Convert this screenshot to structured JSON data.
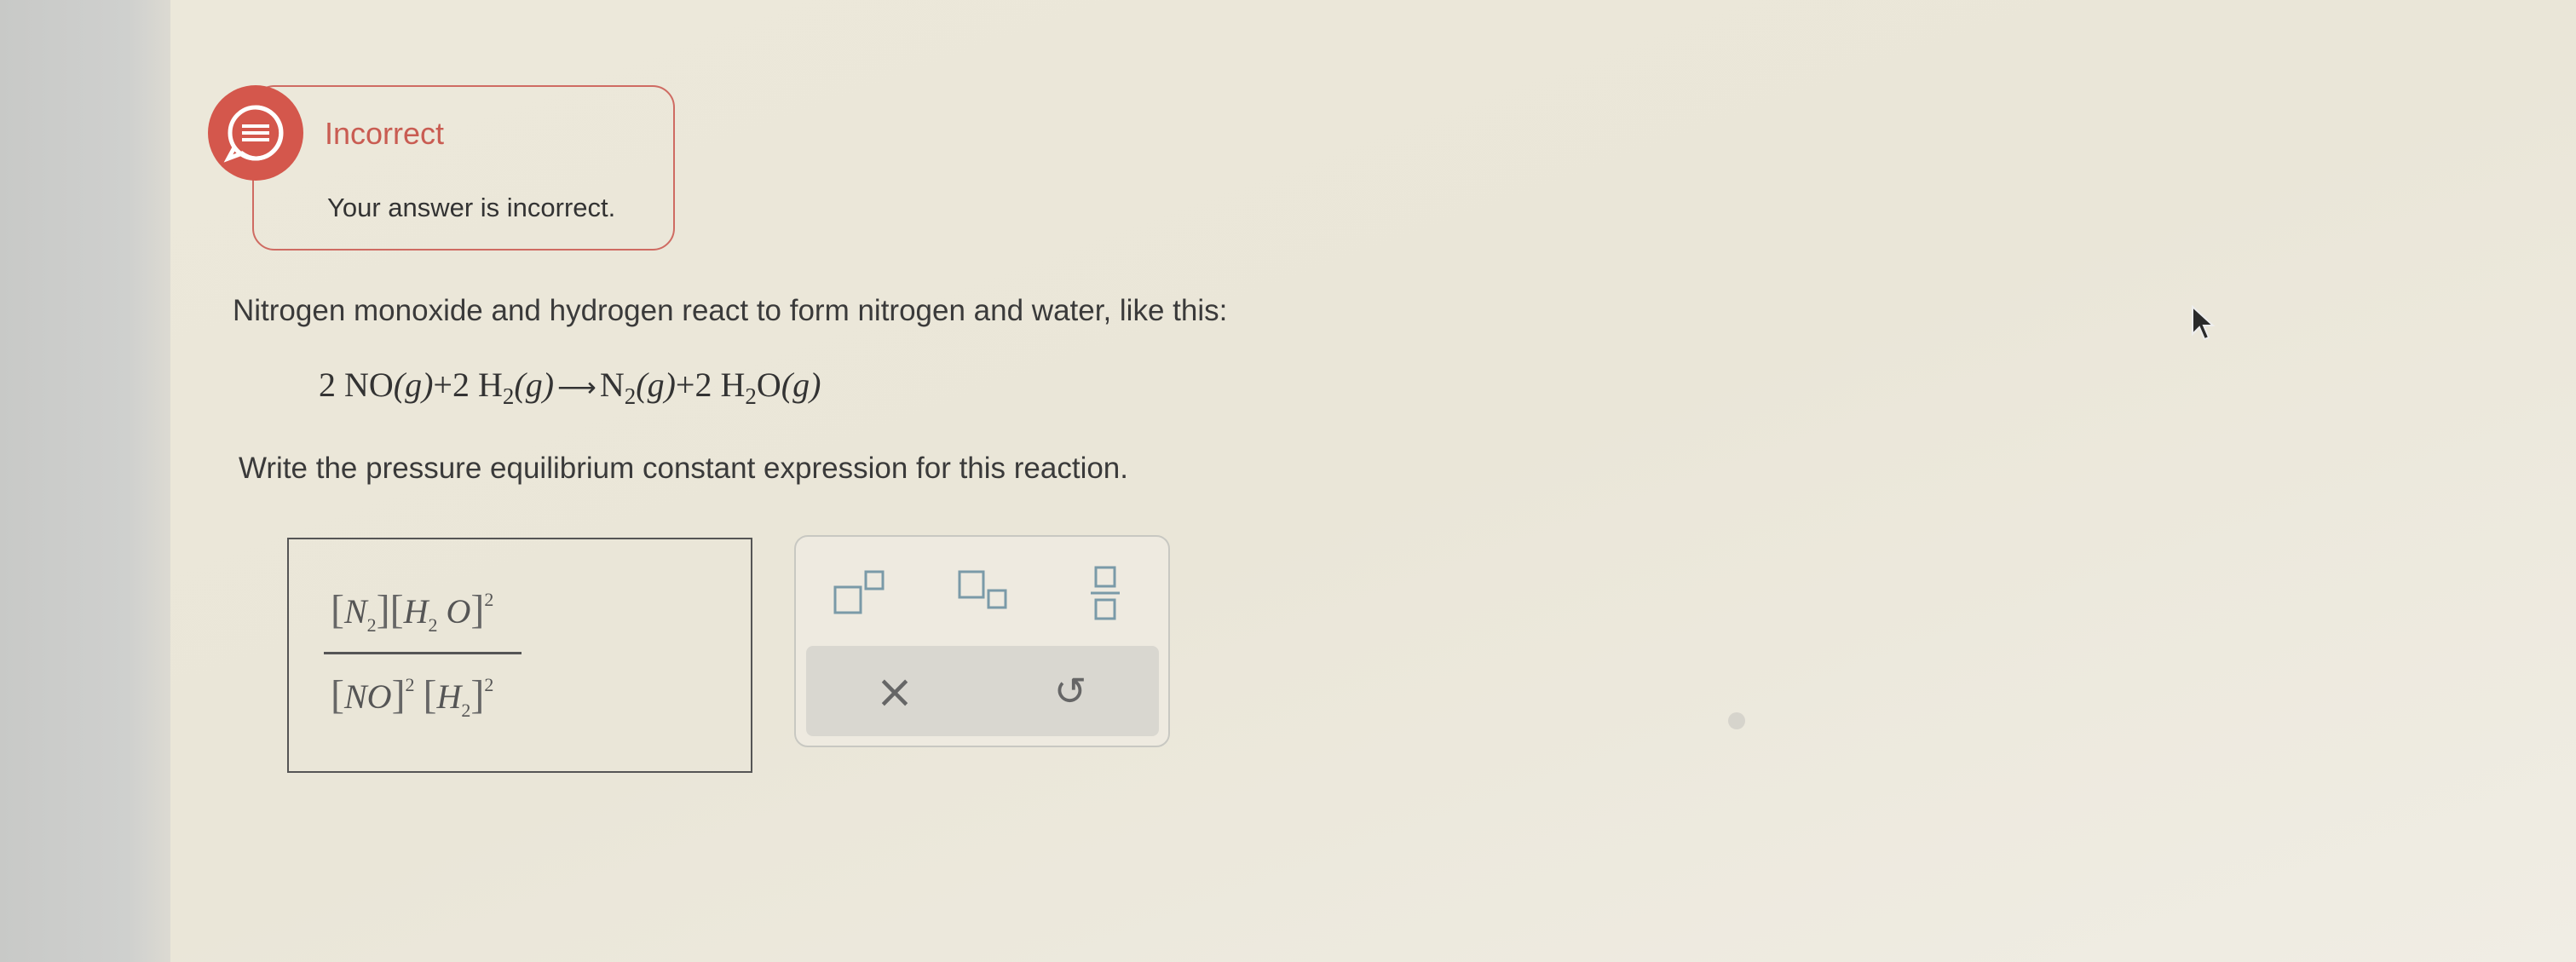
{
  "feedback": {
    "title": "Incorrect",
    "message": "Your answer is incorrect."
  },
  "problem": {
    "intro": "Nitrogen monoxide and hydrogen react to form nitrogen and water, like this:",
    "equation": {
      "reactant1_coef": "2",
      "reactant1": "NO",
      "reactant1_state": "(g)",
      "plus1": "+",
      "reactant2_coef": "2",
      "reactant2": "H",
      "reactant2_sub": "2",
      "reactant2_state": "(g)",
      "product1": "N",
      "product1_sub": "2",
      "product1_state": "(g)",
      "plus2": "+",
      "product2_coef": "2",
      "product2_h": "H",
      "product2_sub": "2",
      "product2_o": "O",
      "product2_state": "(g)"
    },
    "instruction": "Write the pressure equilibrium constant expression for this reaction."
  },
  "answer": {
    "numerator": {
      "term1": "N",
      "term1_sub": "2",
      "term2_a": "H",
      "term2_sub": "2",
      "term2_b": "O",
      "term2_exp": "2"
    },
    "denominator": {
      "term1": "NO",
      "term1_exp": "2",
      "term2": "H",
      "term2_sub": "2",
      "term2_exp": "2"
    }
  },
  "palette": {
    "buttons": [
      "superscript-template",
      "subscript-template",
      "fraction-template"
    ],
    "clear_symbol": "×",
    "undo_symbol": "↺"
  },
  "colors": {
    "incorrect_accent": "#d4574c",
    "palette_box_color": "#7a9aa8"
  }
}
